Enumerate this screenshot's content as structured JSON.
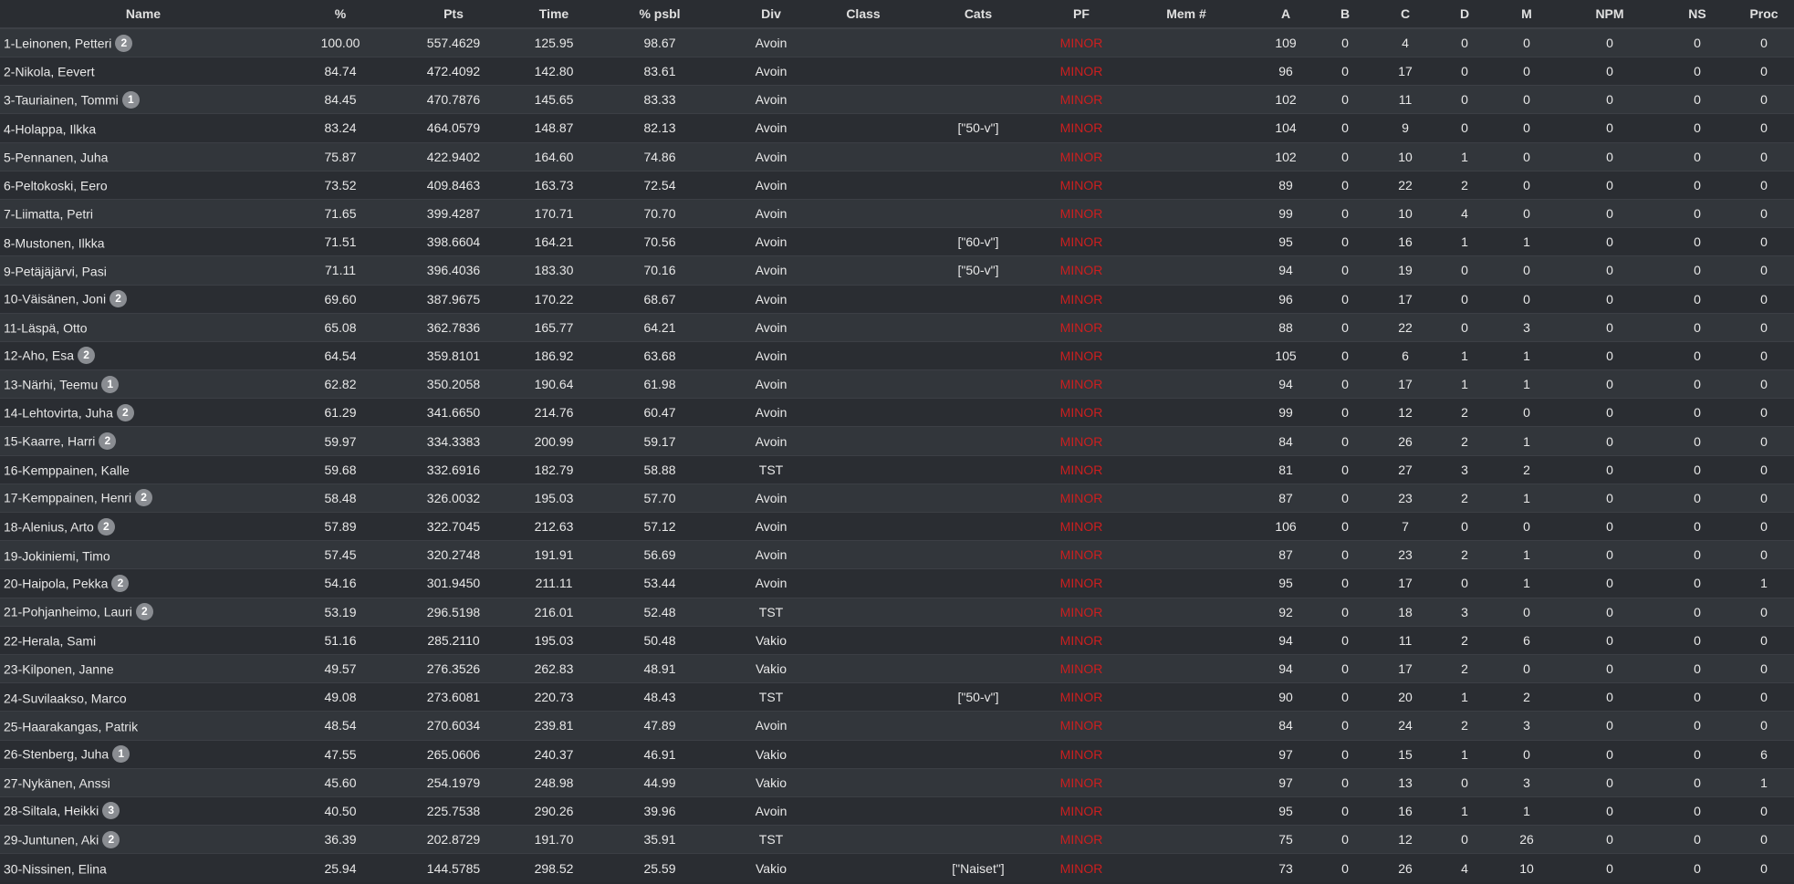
{
  "table": {
    "headers": [
      "Name",
      "%",
      "Pts",
      "Time",
      "% psbl",
      "Div",
      "Class",
      "Cats",
      "PF",
      "Mem #",
      "A",
      "B",
      "C",
      "D",
      "M",
      "NPM",
      "NS",
      "Proc"
    ],
    "rows": [
      {
        "name": "1-Leinonen, Petteri",
        "badge": "2",
        "pct": "100.00",
        "pts": "557.4629",
        "time": "125.95",
        "psbl": "98.67",
        "div": "Avoin",
        "cls": "",
        "cats": "",
        "pf": "MINOR",
        "mem": "",
        "a": "109",
        "b": "0",
        "c": "4",
        "d": "0",
        "m": "0",
        "npm": "0",
        "ns": "0",
        "proc": "0"
      },
      {
        "name": "2-Nikola, Eevert",
        "badge": "",
        "pct": "84.74",
        "pts": "472.4092",
        "time": "142.80",
        "psbl": "83.61",
        "div": "Avoin",
        "cls": "",
        "cats": "",
        "pf": "MINOR",
        "mem": "",
        "a": "96",
        "b": "0",
        "c": "17",
        "d": "0",
        "m": "0",
        "npm": "0",
        "ns": "0",
        "proc": "0"
      },
      {
        "name": "3-Tauriainen, Tommi",
        "badge": "1",
        "pct": "84.45",
        "pts": "470.7876",
        "time": "145.65",
        "psbl": "83.33",
        "div": "Avoin",
        "cls": "",
        "cats": "",
        "pf": "MINOR",
        "mem": "",
        "a": "102",
        "b": "0",
        "c": "11",
        "d": "0",
        "m": "0",
        "npm": "0",
        "ns": "0",
        "proc": "0"
      },
      {
        "name": "4-Holappa, Ilkka",
        "badge": "",
        "pct": "83.24",
        "pts": "464.0579",
        "time": "148.87",
        "psbl": "82.13",
        "div": "Avoin",
        "cls": "",
        "cats": "[\"50-v\"]",
        "pf": "MINOR",
        "mem": "",
        "a": "104",
        "b": "0",
        "c": "9",
        "d": "0",
        "m": "0",
        "npm": "0",
        "ns": "0",
        "proc": "0"
      },
      {
        "name": "5-Pennanen, Juha",
        "badge": "",
        "pct": "75.87",
        "pts": "422.9402",
        "time": "164.60",
        "psbl": "74.86",
        "div": "Avoin",
        "cls": "",
        "cats": "",
        "pf": "MINOR",
        "mem": "",
        "a": "102",
        "b": "0",
        "c": "10",
        "d": "1",
        "m": "0",
        "npm": "0",
        "ns": "0",
        "proc": "0"
      },
      {
        "name": "6-Peltokoski, Eero",
        "badge": "",
        "pct": "73.52",
        "pts": "409.8463",
        "time": "163.73",
        "psbl": "72.54",
        "div": "Avoin",
        "cls": "",
        "cats": "",
        "pf": "MINOR",
        "mem": "",
        "a": "89",
        "b": "0",
        "c": "22",
        "d": "2",
        "m": "0",
        "npm": "0",
        "ns": "0",
        "proc": "0"
      },
      {
        "name": "7-Liimatta, Petri",
        "badge": "",
        "pct": "71.65",
        "pts": "399.4287",
        "time": "170.71",
        "psbl": "70.70",
        "div": "Avoin",
        "cls": "",
        "cats": "",
        "pf": "MINOR",
        "mem": "",
        "a": "99",
        "b": "0",
        "c": "10",
        "d": "4",
        "m": "0",
        "npm": "0",
        "ns": "0",
        "proc": "0"
      },
      {
        "name": "8-Mustonen, Ilkka",
        "badge": "",
        "pct": "71.51",
        "pts": "398.6604",
        "time": "164.21",
        "psbl": "70.56",
        "div": "Avoin",
        "cls": "",
        "cats": "[\"60-v\"]",
        "pf": "MINOR",
        "mem": "",
        "a": "95",
        "b": "0",
        "c": "16",
        "d": "1",
        "m": "1",
        "npm": "0",
        "ns": "0",
        "proc": "0"
      },
      {
        "name": "9-Petäjäjärvi, Pasi",
        "badge": "",
        "pct": "71.11",
        "pts": "396.4036",
        "time": "183.30",
        "psbl": "70.16",
        "div": "Avoin",
        "cls": "",
        "cats": "[\"50-v\"]",
        "pf": "MINOR",
        "mem": "",
        "a": "94",
        "b": "0",
        "c": "19",
        "d": "0",
        "m": "0",
        "npm": "0",
        "ns": "0",
        "proc": "0"
      },
      {
        "name": "10-Väisänen, Joni",
        "badge": "2",
        "pct": "69.60",
        "pts": "387.9675",
        "time": "170.22",
        "psbl": "68.67",
        "div": "Avoin",
        "cls": "",
        "cats": "",
        "pf": "MINOR",
        "mem": "",
        "a": "96",
        "b": "0",
        "c": "17",
        "d": "0",
        "m": "0",
        "npm": "0",
        "ns": "0",
        "proc": "0"
      },
      {
        "name": "11-Läspä, Otto",
        "badge": "",
        "pct": "65.08",
        "pts": "362.7836",
        "time": "165.77",
        "psbl": "64.21",
        "div": "Avoin",
        "cls": "",
        "cats": "",
        "pf": "MINOR",
        "mem": "",
        "a": "88",
        "b": "0",
        "c": "22",
        "d": "0",
        "m": "3",
        "npm": "0",
        "ns": "0",
        "proc": "0"
      },
      {
        "name": "12-Aho, Esa",
        "badge": "2",
        "pct": "64.54",
        "pts": "359.8101",
        "time": "186.92",
        "psbl": "63.68",
        "div": "Avoin",
        "cls": "",
        "cats": "",
        "pf": "MINOR",
        "mem": "",
        "a": "105",
        "b": "0",
        "c": "6",
        "d": "1",
        "m": "1",
        "npm": "0",
        "ns": "0",
        "proc": "0"
      },
      {
        "name": "13-Närhi, Teemu",
        "badge": "1",
        "pct": "62.82",
        "pts": "350.2058",
        "time": "190.64",
        "psbl": "61.98",
        "div": "Avoin",
        "cls": "",
        "cats": "",
        "pf": "MINOR",
        "mem": "",
        "a": "94",
        "b": "0",
        "c": "17",
        "d": "1",
        "m": "1",
        "npm": "0",
        "ns": "0",
        "proc": "0"
      },
      {
        "name": "14-Lehtovirta, Juha",
        "badge": "2",
        "pct": "61.29",
        "pts": "341.6650",
        "time": "214.76",
        "psbl": "60.47",
        "div": "Avoin",
        "cls": "",
        "cats": "",
        "pf": "MINOR",
        "mem": "",
        "a": "99",
        "b": "0",
        "c": "12",
        "d": "2",
        "m": "0",
        "npm": "0",
        "ns": "0",
        "proc": "0"
      },
      {
        "name": "15-Kaarre, Harri",
        "badge": "2",
        "pct": "59.97",
        "pts": "334.3383",
        "time": "200.99",
        "psbl": "59.17",
        "div": "Avoin",
        "cls": "",
        "cats": "",
        "pf": "MINOR",
        "mem": "",
        "a": "84",
        "b": "0",
        "c": "26",
        "d": "2",
        "m": "1",
        "npm": "0",
        "ns": "0",
        "proc": "0"
      },
      {
        "name": "16-Kemppainen, Kalle",
        "badge": "",
        "pct": "59.68",
        "pts": "332.6916",
        "time": "182.79",
        "psbl": "58.88",
        "div": "TST",
        "cls": "",
        "cats": "",
        "pf": "MINOR",
        "mem": "",
        "a": "81",
        "b": "0",
        "c": "27",
        "d": "3",
        "m": "2",
        "npm": "0",
        "ns": "0",
        "proc": "0"
      },
      {
        "name": "17-Kemppainen, Henri",
        "badge": "2",
        "pct": "58.48",
        "pts": "326.0032",
        "time": "195.03",
        "psbl": "57.70",
        "div": "Avoin",
        "cls": "",
        "cats": "",
        "pf": "MINOR",
        "mem": "",
        "a": "87",
        "b": "0",
        "c": "23",
        "d": "2",
        "m": "1",
        "npm": "0",
        "ns": "0",
        "proc": "0"
      },
      {
        "name": "18-Alenius, Arto",
        "badge": "2",
        "pct": "57.89",
        "pts": "322.7045",
        "time": "212.63",
        "psbl": "57.12",
        "div": "Avoin",
        "cls": "",
        "cats": "",
        "pf": "MINOR",
        "mem": "",
        "a": "106",
        "b": "0",
        "c": "7",
        "d": "0",
        "m": "0",
        "npm": "0",
        "ns": "0",
        "proc": "0"
      },
      {
        "name": "19-Jokiniemi, Timo",
        "badge": "",
        "pct": "57.45",
        "pts": "320.2748",
        "time": "191.91",
        "psbl": "56.69",
        "div": "Avoin",
        "cls": "",
        "cats": "",
        "pf": "MINOR",
        "mem": "",
        "a": "87",
        "b": "0",
        "c": "23",
        "d": "2",
        "m": "1",
        "npm": "0",
        "ns": "0",
        "proc": "0"
      },
      {
        "name": "20-Haipola, Pekka",
        "badge": "2",
        "pct": "54.16",
        "pts": "301.9450",
        "time": "211.11",
        "psbl": "53.44",
        "div": "Avoin",
        "cls": "",
        "cats": "",
        "pf": "MINOR",
        "mem": "",
        "a": "95",
        "b": "0",
        "c": "17",
        "d": "0",
        "m": "1",
        "npm": "0",
        "ns": "0",
        "proc": "1"
      },
      {
        "name": "21-Pohjanheimo, Lauri",
        "badge": "2",
        "pct": "53.19",
        "pts": "296.5198",
        "time": "216.01",
        "psbl": "52.48",
        "div": "TST",
        "cls": "",
        "cats": "",
        "pf": "MINOR",
        "mem": "",
        "a": "92",
        "b": "0",
        "c": "18",
        "d": "3",
        "m": "0",
        "npm": "0",
        "ns": "0",
        "proc": "0"
      },
      {
        "name": "22-Herala, Sami",
        "badge": "",
        "pct": "51.16",
        "pts": "285.2110",
        "time": "195.03",
        "psbl": "50.48",
        "div": "Vakio",
        "cls": "",
        "cats": "",
        "pf": "MINOR",
        "mem": "",
        "a": "94",
        "b": "0",
        "c": "11",
        "d": "2",
        "m": "6",
        "npm": "0",
        "ns": "0",
        "proc": "0"
      },
      {
        "name": "23-Kilponen, Janne",
        "badge": "",
        "pct": "49.57",
        "pts": "276.3526",
        "time": "262.83",
        "psbl": "48.91",
        "div": "Vakio",
        "cls": "",
        "cats": "",
        "pf": "MINOR",
        "mem": "",
        "a": "94",
        "b": "0",
        "c": "17",
        "d": "2",
        "m": "0",
        "npm": "0",
        "ns": "0",
        "proc": "0"
      },
      {
        "name": "24-Suvilaakso, Marco",
        "badge": "",
        "pct": "49.08",
        "pts": "273.6081",
        "time": "220.73",
        "psbl": "48.43",
        "div": "TST",
        "cls": "",
        "cats": "[\"50-v\"]",
        "pf": "MINOR",
        "mem": "",
        "a": "90",
        "b": "0",
        "c": "20",
        "d": "1",
        "m": "2",
        "npm": "0",
        "ns": "0",
        "proc": "0"
      },
      {
        "name": "25-Haarakangas, Patrik",
        "badge": "",
        "pct": "48.54",
        "pts": "270.6034",
        "time": "239.81",
        "psbl": "47.89",
        "div": "Avoin",
        "cls": "",
        "cats": "",
        "pf": "MINOR",
        "mem": "",
        "a": "84",
        "b": "0",
        "c": "24",
        "d": "2",
        "m": "3",
        "npm": "0",
        "ns": "0",
        "proc": "0"
      },
      {
        "name": "26-Stenberg, Juha",
        "badge": "1",
        "pct": "47.55",
        "pts": "265.0606",
        "time": "240.37",
        "psbl": "46.91",
        "div": "Vakio",
        "cls": "",
        "cats": "",
        "pf": "MINOR",
        "mem": "",
        "a": "97",
        "b": "0",
        "c": "15",
        "d": "1",
        "m": "0",
        "npm": "0",
        "ns": "0",
        "proc": "6"
      },
      {
        "name": "27-Nykänen, Anssi",
        "badge": "",
        "pct": "45.60",
        "pts": "254.1979",
        "time": "248.98",
        "psbl": "44.99",
        "div": "Vakio",
        "cls": "",
        "cats": "",
        "pf": "MINOR",
        "mem": "",
        "a": "97",
        "b": "0",
        "c": "13",
        "d": "0",
        "m": "3",
        "npm": "0",
        "ns": "0",
        "proc": "1"
      },
      {
        "name": "28-Siltala, Heikki",
        "badge": "3",
        "pct": "40.50",
        "pts": "225.7538",
        "time": "290.26",
        "psbl": "39.96",
        "div": "Avoin",
        "cls": "",
        "cats": "",
        "pf": "MINOR",
        "mem": "",
        "a": "95",
        "b": "0",
        "c": "16",
        "d": "1",
        "m": "1",
        "npm": "0",
        "ns": "0",
        "proc": "0"
      },
      {
        "name": "29-Juntunen, Aki",
        "badge": "2",
        "pct": "36.39",
        "pts": "202.8729",
        "time": "191.70",
        "psbl": "35.91",
        "div": "TST",
        "cls": "",
        "cats": "",
        "pf": "MINOR",
        "mem": "",
        "a": "75",
        "b": "0",
        "c": "12",
        "d": "0",
        "m": "26",
        "npm": "0",
        "ns": "0",
        "proc": "0"
      },
      {
        "name": "30-Nissinen, Elina",
        "badge": "",
        "pct": "25.94",
        "pts": "144.5785",
        "time": "298.52",
        "psbl": "25.59",
        "div": "Vakio",
        "cls": "",
        "cats": "[\"Naiset\"]",
        "pf": "MINOR",
        "mem": "",
        "a": "73",
        "b": "0",
        "c": "26",
        "d": "4",
        "m": "10",
        "npm": "0",
        "ns": "0",
        "proc": "0"
      }
    ]
  },
  "colors": {
    "background": "#282b30",
    "row_odd": "#32363b",
    "row_even": "#2a2d32",
    "pf_text": "#cc1f1f",
    "badge": "#8a8d92"
  }
}
